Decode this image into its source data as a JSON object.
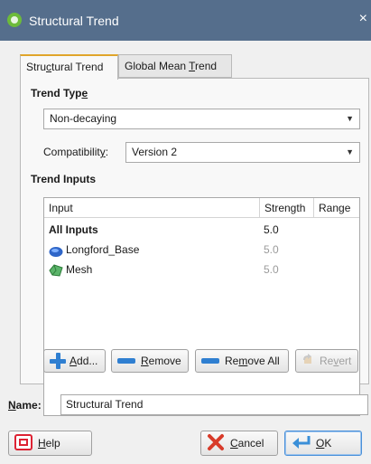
{
  "window": {
    "title": "Structural Trend",
    "close_glyph": "×"
  },
  "tabs": [
    {
      "label": "Structural Trend",
      "mnemonic_pre": "Stru",
      "mnemonic": "c",
      "mnemonic_post": "tural Trend",
      "active": true
    },
    {
      "label": "Global Mean Trend",
      "mnemonic_pre": "Global Mean ",
      "mnemonic": "T",
      "mnemonic_post": "rend",
      "active": false
    }
  ],
  "trend_type": {
    "heading_pre": "Trend Typ",
    "heading_mn": "e",
    "value": "Non-decaying"
  },
  "compatibility": {
    "label_pre": "Compatibilit",
    "label_mn": "y",
    "label_post": ":",
    "value": "Version 2"
  },
  "trend_inputs": {
    "heading": "Trend Inputs",
    "columns": [
      "Input",
      "Strength",
      "Range"
    ],
    "rows": [
      {
        "name": "All Inputs",
        "strength": "5.0",
        "range": "",
        "bold": true,
        "icon": "none"
      },
      {
        "name": "Longford_Base",
        "strength": "5.0",
        "range": "",
        "bold": false,
        "icon": "surface-icon"
      },
      {
        "name": "Mesh",
        "strength": "5.0",
        "range": "",
        "bold": false,
        "icon": "mesh-icon"
      }
    ]
  },
  "buttons": {
    "add": {
      "pre": "",
      "mn": "A",
      "post": "dd...",
      "icon": "plus-icon"
    },
    "remove": {
      "pre": "",
      "mn": "R",
      "post": "emove",
      "icon": "minus-icon"
    },
    "remove_all": {
      "pre": "Re",
      "mn": "m",
      "post": "ove All",
      "icon": "minus-icon"
    },
    "revert": {
      "pre": "Re",
      "mn": "v",
      "post": "ert",
      "icon": "revert-icon",
      "enabled": false
    }
  },
  "name_field": {
    "label_mn": "N",
    "label_post": "ame:",
    "value": "Structural Trend"
  },
  "footer": {
    "help": {
      "mn": "H",
      "post": "elp",
      "icon": "help-icon"
    },
    "cancel": {
      "mn": "C",
      "post": "ancel",
      "icon": "cancel-icon"
    },
    "ok": {
      "mn": "O",
      "post": "K",
      "icon": "ok-icon"
    }
  },
  "colors": {
    "titlebar": "#556e8c",
    "accent": "#e0a52a",
    "icon_blue": "#2f7fd1"
  }
}
